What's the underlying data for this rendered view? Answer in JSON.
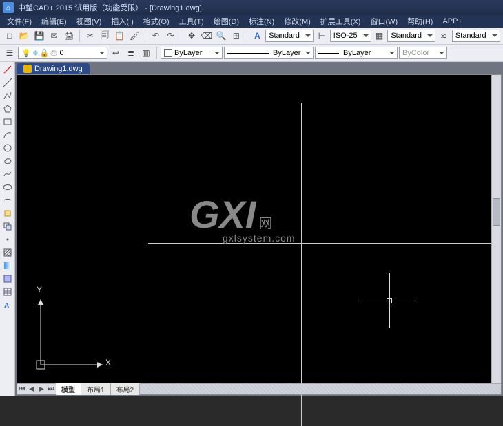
{
  "app": {
    "title": "中望CAD+ 2015 试用版（功能受限） - [Drawing1.dwg]",
    "logo_char": "⌂"
  },
  "menu": {
    "items": [
      "文件(F)",
      "编辑(E)",
      "视图(V)",
      "插入(I)",
      "格式(O)",
      "工具(T)",
      "绘图(D)",
      "标注(N)",
      "修改(M)",
      "扩展工具(X)",
      "窗口(W)",
      "帮助(H)",
      "APP+"
    ]
  },
  "toolbar1": {
    "style_dd": "Standard",
    "dim_dd": "ISO-25",
    "tblstyle_dd": "Standard",
    "mlstyle_dd": "Standard"
  },
  "toolbar2": {
    "layer_dd": "0",
    "color_dd": "ByLayer",
    "linetype_dd": "ByLayer",
    "lineweight_dd": "ByLayer",
    "plotstyle_dd": "ByColor"
  },
  "doc": {
    "tab_label": "Drawing1.dwg"
  },
  "watermark": {
    "big": "GXI",
    "small": "网",
    "sub": "gxlsystem.com"
  },
  "ucs": {
    "x": "X",
    "y": "Y"
  },
  "layout": {
    "tabs": [
      "模型",
      "布局1",
      "布局2"
    ]
  },
  "icons": {
    "new": "□",
    "open": "📂",
    "save": "💾",
    "mail": "✉",
    "print": "🖨",
    "cut": "✂",
    "copy": "🗐",
    "paste": "📋",
    "undo": "↶",
    "redo": "↷",
    "pan": "✥",
    "erase": "⌫",
    "find": "🔍",
    "text": "A",
    "dim": "⊢",
    "table": "▦",
    "mline": "≋"
  }
}
